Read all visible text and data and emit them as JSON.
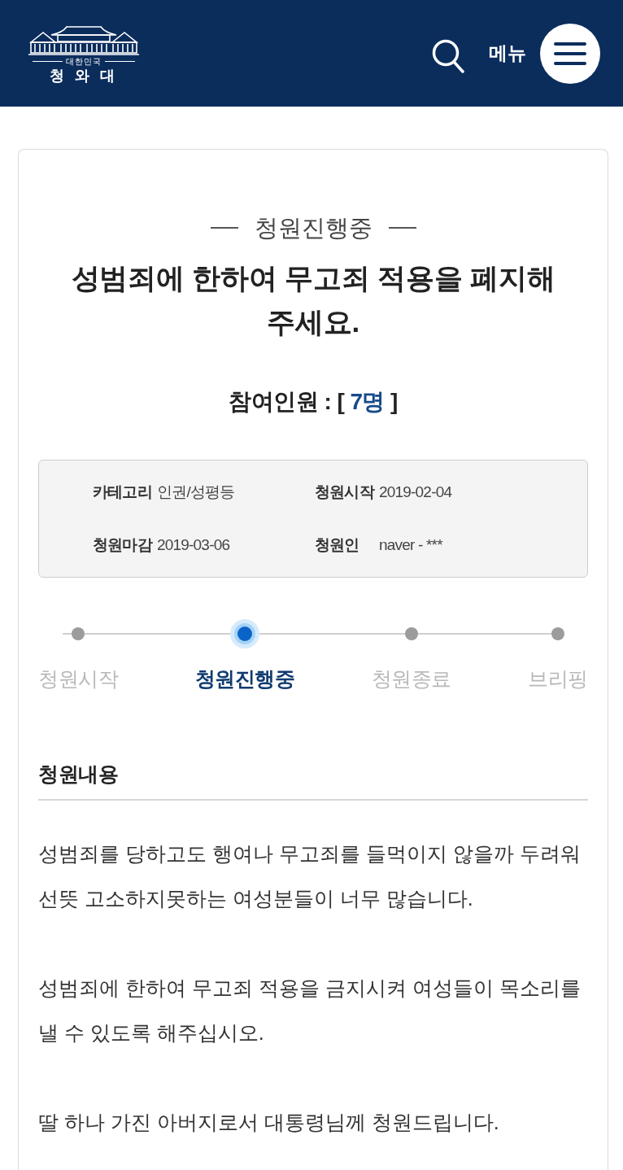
{
  "header": {
    "logo": {
      "subtitle": "대한민국",
      "name": "청 와 대"
    },
    "menu_label": "메뉴"
  },
  "petition": {
    "status": "청원진행중",
    "title": "성범죄에 한하여 무고죄 적용을 폐지해 주세요.",
    "participants": {
      "label": "참여인원 : [",
      "count": "7명",
      "suffix": "]"
    },
    "details": [
      {
        "label": "카테고리",
        "value": "인권/성평등"
      },
      {
        "label": "청원시작",
        "value": "2019-02-04"
      },
      {
        "label": "청원마감",
        "value": "2019-03-06"
      },
      {
        "label": "청원인",
        "value": "naver - ***"
      }
    ],
    "steps": [
      {
        "label": "청원시작",
        "selected": false
      },
      {
        "label": "청원진행중",
        "selected": true
      },
      {
        "label": "청원종료",
        "selected": false
      },
      {
        "label": "브리핑",
        "selected": false
      }
    ],
    "content": {
      "heading": "청원내용",
      "paragraphs": [
        "성범죄를 당하고도 행여나 무고죄를 들먹이지 않을까 두려워 선뜻 고소하지못하는 여성분들이 너무 많습니다.",
        "성범죄에 한하여 무고죄 적용을 금지시켜 여성들이 목소리를 낼 수 있도록 해주십시오.",
        "딸 하나 가진 아버지로서 대통령님께 청원드립니다."
      ]
    }
  }
}
